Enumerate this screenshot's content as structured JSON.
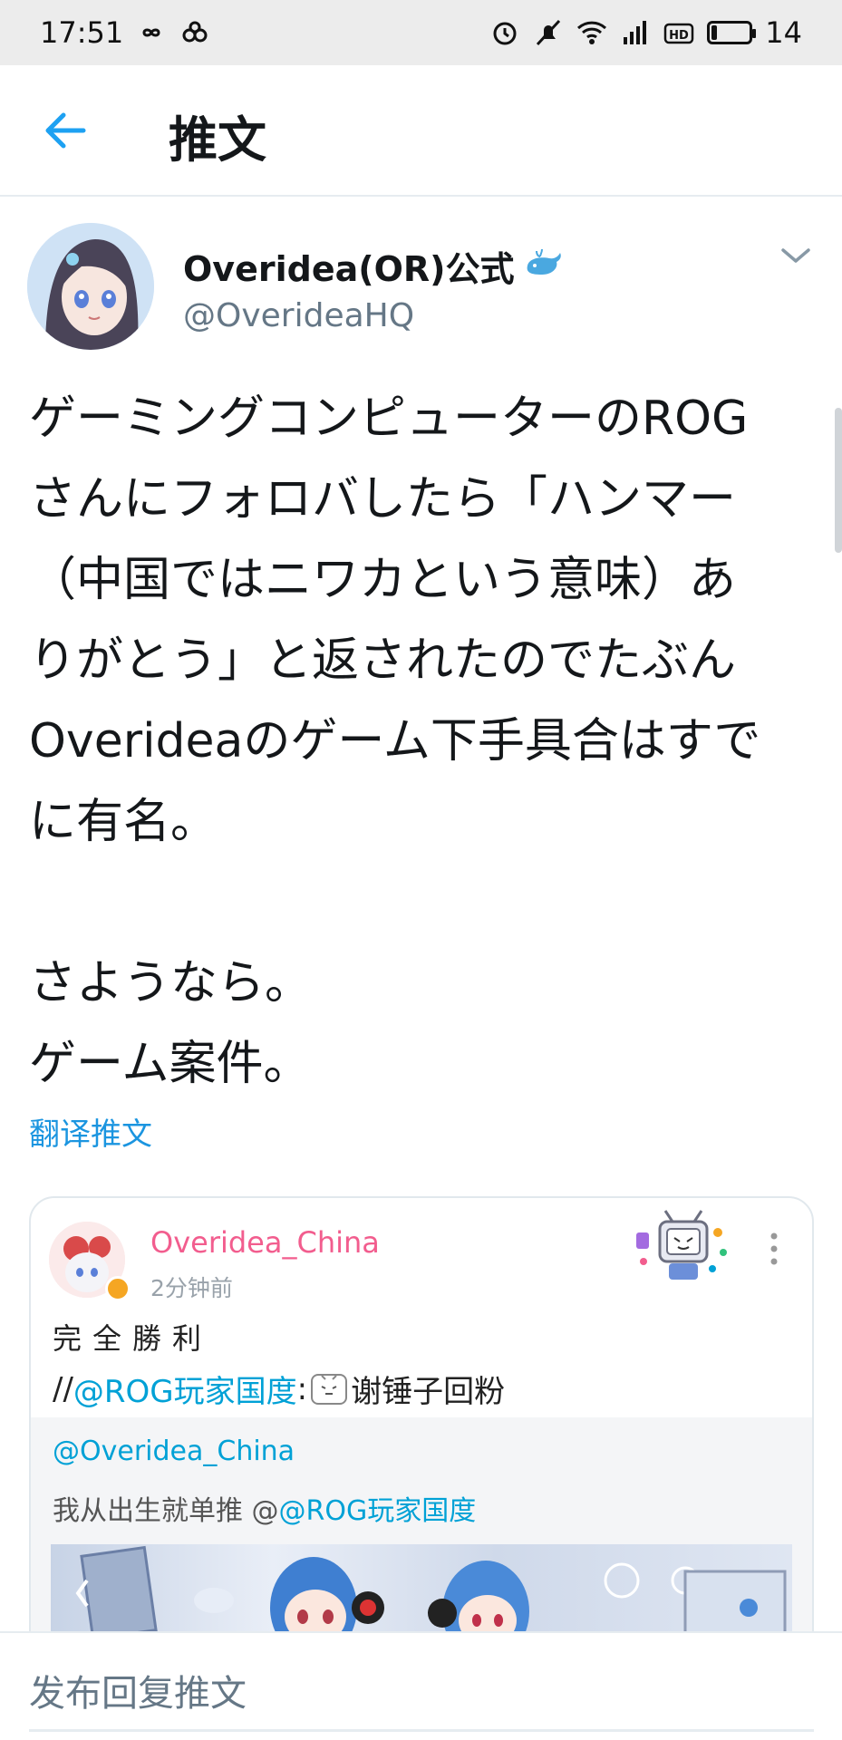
{
  "status_bar": {
    "time": "17:51",
    "battery": "14",
    "icons": [
      "infinity-icon",
      "link-icon",
      "alarm-icon",
      "mute-icon",
      "wifi-icon",
      "signal-4g-icon",
      "hd-icon",
      "battery-icon"
    ]
  },
  "header": {
    "back_icon": "back-arrow-icon",
    "title": "推文"
  },
  "tweet": {
    "display_name": "Overidea(OR)公式",
    "handle": "@OverideaHQ",
    "text": "ゲーミングコンピューターのROG\nさんにフォロバしたら「ハンマー\n（中国ではニワカという意味）あ\nりがとう」と返されたのでたぶん\nOverideaのゲーム下手具合はすで\nに有名。\n\nさようなら。\nゲーム案件。",
    "translate_label": "翻译推文"
  },
  "embedded_card": {
    "username": "Overidea_China",
    "time": "2分钟前",
    "text_line1": "完全勝利",
    "text_line2_prefix": "//",
    "text_line2_mention": "@ROG玩家国度",
    "text_line2_colon": ":",
    "text_line2_suffix": "谢锤子回粉",
    "repost": {
      "user": "@Overidea_China",
      "text_prefix": "我从出生就单推 @",
      "text_mention": "@ROG玩家国度"
    }
  },
  "reply": {
    "placeholder": "发布回复推文"
  },
  "colors": {
    "twitter_blue": "#1b95e0",
    "bili_pink": "#f25d8e",
    "bili_blue": "#00a1d6"
  }
}
